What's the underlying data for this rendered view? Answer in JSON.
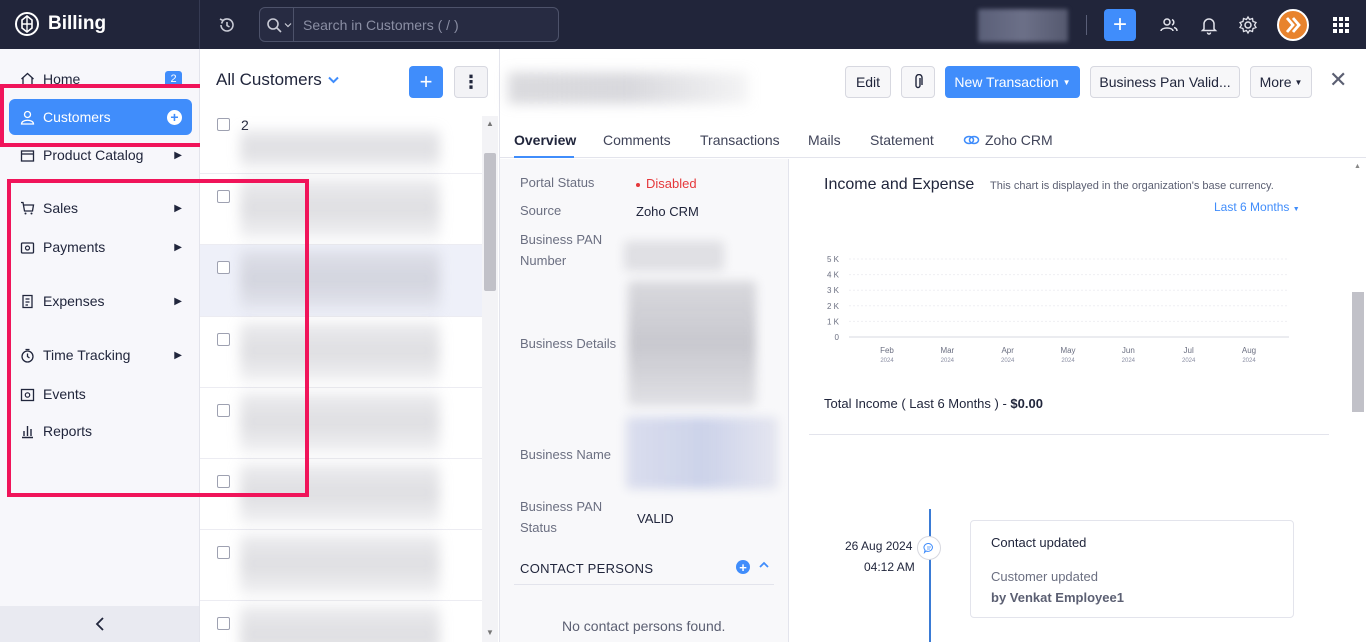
{
  "app": {
    "title": "Billing"
  },
  "search": {
    "placeholder": "Search in Customers ( / )"
  },
  "sidebar": {
    "items": [
      {
        "label": "Home",
        "badge": "2"
      },
      {
        "label": "Customers"
      },
      {
        "label": "Product Catalog"
      },
      {
        "label": "Sales"
      },
      {
        "label": "Payments"
      },
      {
        "label": "Expenses"
      },
      {
        "label": "Time Tracking"
      },
      {
        "label": "Events"
      },
      {
        "label": "Reports"
      }
    ]
  },
  "list": {
    "title": "All Customers",
    "first_row_number": "2"
  },
  "detail": {
    "buttons": {
      "edit": "Edit",
      "new_transaction": "New Transaction",
      "business_pan": "Business Pan Valid...",
      "more": "More"
    },
    "tabs": [
      "Overview",
      "Comments",
      "Transactions",
      "Mails",
      "Statement",
      "Zoho CRM"
    ],
    "fields": {
      "portal_status_label": "Portal Status",
      "portal_status_value": "Disabled",
      "source_label": "Source",
      "source_value": "Zoho CRM",
      "pan_number_label_1": "Business PAN",
      "pan_number_label_2": "Number",
      "business_details_label": "Business Details",
      "business_name_label": "Business Name",
      "pan_status_label_1": "Business PAN",
      "pan_status_label_2": "Status",
      "pan_status_value": "VALID"
    },
    "contact_persons": {
      "title": "CONTACT PERSONS",
      "empty": "No contact persons found."
    },
    "chart": {
      "title": "Income and Expense",
      "note": "This chart is displayed in the organization's base currency.",
      "period": "Last 6 Months",
      "total_label": "Total Income ( Last 6 Months ) -",
      "total_value": "$0.00"
    },
    "timeline": {
      "date": "26 Aug 2024",
      "time": "04:12 AM",
      "title": "Contact updated",
      "subtitle": "Customer updated",
      "by": "by Venkat Employee1"
    }
  },
  "chart_data": {
    "type": "area",
    "title": "Income and Expense",
    "categories": [
      "Feb 2024",
      "Mar 2024",
      "Apr 2024",
      "May 2024",
      "Jun 2024",
      "Jul 2024",
      "Aug 2024"
    ],
    "x_month": [
      "Feb",
      "Mar",
      "Apr",
      "May",
      "Jun",
      "Jul",
      "Aug"
    ],
    "x_year": [
      "2024",
      "2024",
      "2024",
      "2024",
      "2024",
      "2024",
      "2024"
    ],
    "y_ticks": [
      "0",
      "1 K",
      "2 K",
      "3 K",
      "4 K",
      "5 K"
    ],
    "ylim": [
      0,
      5000
    ],
    "series": [
      {
        "values": [
          0,
          0,
          0,
          0,
          0,
          0,
          0
        ]
      }
    ],
    "grid": true
  }
}
